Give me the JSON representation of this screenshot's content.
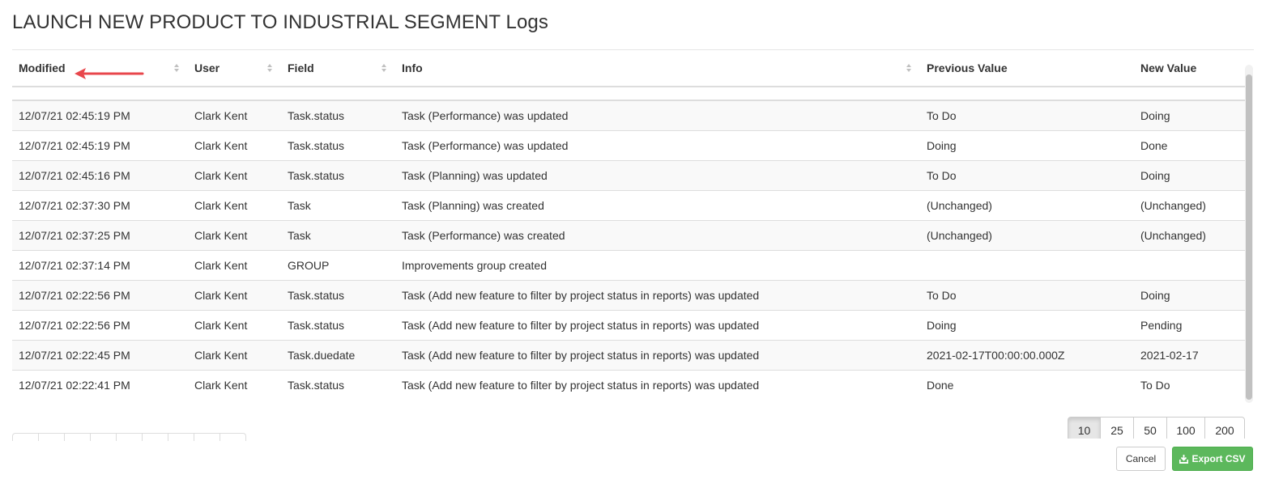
{
  "modal": {
    "title": "LAUNCH NEW PRODUCT TO INDUSTRIAL SEGMENT Logs"
  },
  "table": {
    "columns": [
      {
        "label": "Modified",
        "sortable": true
      },
      {
        "label": "User",
        "sortable": true
      },
      {
        "label": "Field",
        "sortable": true
      },
      {
        "label": "Info",
        "sortable": true
      },
      {
        "label": "Previous Value",
        "sortable": false
      },
      {
        "label": "New Value",
        "sortable": false
      }
    ],
    "rows": [
      {
        "modified": "12/07/21 02:45:19 PM",
        "user": "Clark Kent",
        "field": "Task.status",
        "info": "Task (Performance) was updated",
        "prev": "To Do",
        "new": "Doing"
      },
      {
        "modified": "12/07/21 02:45:19 PM",
        "user": "Clark Kent",
        "field": "Task.status",
        "info": "Task (Performance) was updated",
        "prev": "Doing",
        "new": "Done"
      },
      {
        "modified": "12/07/21 02:45:16 PM",
        "user": "Clark Kent",
        "field": "Task.status",
        "info": "Task (Planning) was updated",
        "prev": "To Do",
        "new": "Doing"
      },
      {
        "modified": "12/07/21 02:37:30 PM",
        "user": "Clark Kent",
        "field": "Task",
        "info": "Task (Planning) was created",
        "prev": "(Unchanged)",
        "new": "(Unchanged)"
      },
      {
        "modified": "12/07/21 02:37:25 PM",
        "user": "Clark Kent",
        "field": "Task",
        "info": "Task (Performance) was created",
        "prev": "(Unchanged)",
        "new": "(Unchanged)"
      },
      {
        "modified": "12/07/21 02:37:14 PM",
        "user": "Clark Kent",
        "field": "GROUP",
        "info": "Improvements group created",
        "prev": "",
        "new": ""
      },
      {
        "modified": "12/07/21 02:22:56 PM",
        "user": "Clark Kent",
        "field": "Task.status",
        "info": "Task (Add new feature to filter by project status in reports) was updated",
        "prev": "To Do",
        "new": "Doing"
      },
      {
        "modified": "12/07/21 02:22:56 PM",
        "user": "Clark Kent",
        "field": "Task.status",
        "info": "Task (Add new feature to filter by project status in reports) was updated",
        "prev": "Doing",
        "new": "Pending"
      },
      {
        "modified": "12/07/21 02:22:45 PM",
        "user": "Clark Kent",
        "field": "Task.duedate",
        "info": "Task (Add new feature to filter by project status in reports) was updated",
        "prev": "2021-02-17T00:00:00.000Z",
        "new": "2021-02-17"
      },
      {
        "modified": "12/07/21 02:22:41 PM",
        "user": "Clark Kent",
        "field": "Task.status",
        "info": "Task (Add new feature to filter by project status in reports) was updated",
        "prev": "Done",
        "new": "To Do"
      }
    ]
  },
  "pagination": {
    "page_sizes": [
      "10",
      "25",
      "50",
      "100",
      "200"
    ],
    "selected_page_size": "10"
  },
  "footer": {
    "cancel_label": "Cancel",
    "export_label": "Export CSV",
    "export_icon": "download-icon"
  },
  "annotation": {
    "arrow_color": "#e8464b"
  },
  "colors": {
    "export_button": "#5cb85c",
    "annotation_arrow": "#e8464b"
  }
}
